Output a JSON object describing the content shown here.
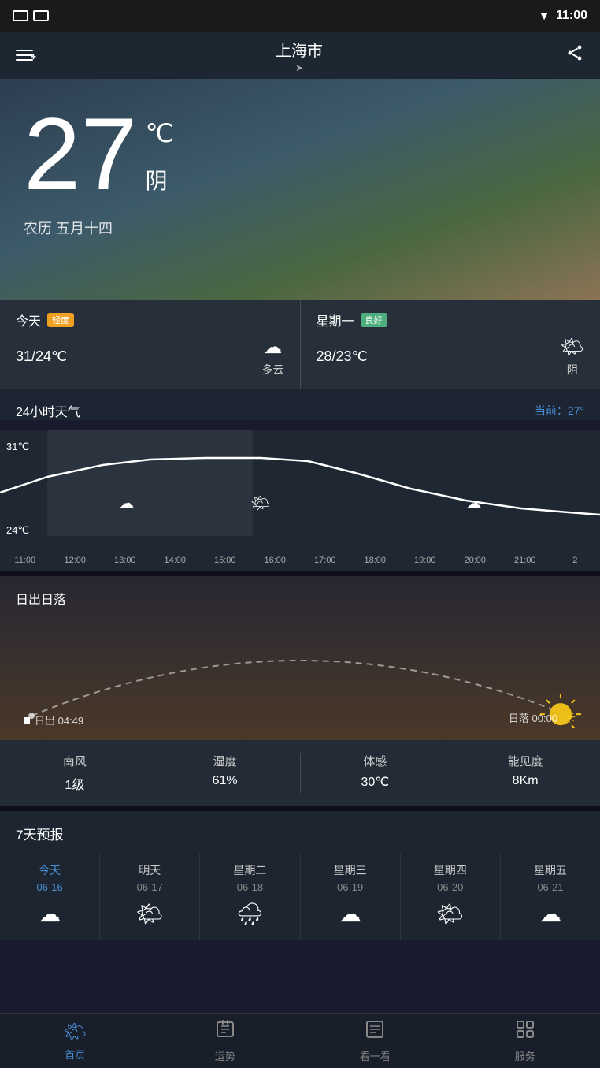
{
  "statusBar": {
    "time": "11:00"
  },
  "header": {
    "city": "上海市",
    "menuLabel": "menu",
    "shareLabel": "share"
  },
  "hero": {
    "temperature": "27",
    "unit": "℃",
    "condition": "阴",
    "lunarDate": "农历 五月十四"
  },
  "todayCard": {
    "label": "今天",
    "badge": "轻度",
    "tempRange": "31/24℃",
    "weatherIcon": "☁",
    "weatherText": "多云"
  },
  "tomorrowCard": {
    "label": "星期一",
    "badge": "良好",
    "tempRange": "28/23℃",
    "weatherIcon": "🌤",
    "weatherText": "阴"
  },
  "hourly": {
    "title": "24小时天气",
    "current": "当前：27°",
    "maxTemp": "31℃",
    "minTemp": "24℃",
    "times": [
      "11:00",
      "12:00",
      "13:00",
      "14:00",
      "15:00",
      "16:00",
      "17:00",
      "18:00",
      "19:00",
      "20:00",
      "21:00",
      "2"
    ]
  },
  "sunrise": {
    "title": "日出日落",
    "riseTime": "日出 04:49",
    "setTime": "日落 00:00"
  },
  "stats": [
    {
      "label": "南风",
      "sublabel": "1级",
      "key": "wind"
    },
    {
      "label": "湿度",
      "sublabel": "61%",
      "key": "humidity"
    },
    {
      "label": "体感",
      "sublabel": "30℃",
      "key": "feels_like"
    },
    {
      "label": "能见度",
      "sublabel": "8Km",
      "key": "visibility"
    }
  ],
  "forecast": {
    "title": "7天预报",
    "days": [
      {
        "name": "今天",
        "date": "06-16",
        "icon": "☁",
        "today": true
      },
      {
        "name": "明天",
        "date": "06-17",
        "icon": "🌤",
        "today": false
      },
      {
        "name": "星期二",
        "date": "06-18",
        "icon": "🌧",
        "today": false
      },
      {
        "name": "星期三",
        "date": "06-19",
        "icon": "☁",
        "today": false
      },
      {
        "name": "星期四",
        "date": "06-20",
        "icon": "🌤",
        "today": false
      },
      {
        "name": "星期五",
        "date": "06-21",
        "icon": "☁",
        "today": false
      }
    ]
  },
  "bottomNav": {
    "items": [
      {
        "label": "首页",
        "icon": "🌤",
        "active": true
      },
      {
        "label": "运势",
        "icon": "📅",
        "active": false
      },
      {
        "label": "看一看",
        "icon": "📰",
        "active": false
      },
      {
        "label": "服务",
        "icon": "⚙",
        "active": false
      }
    ]
  }
}
